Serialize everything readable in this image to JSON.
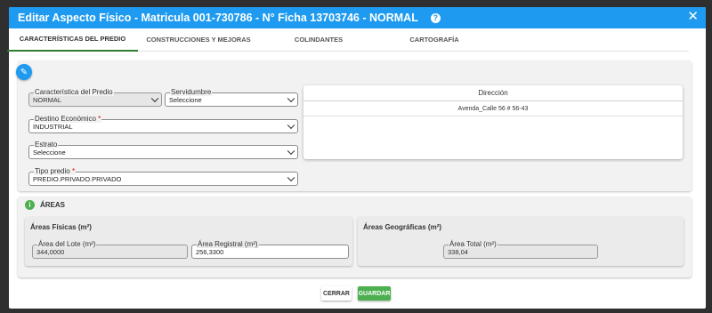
{
  "dialog": {
    "title": "Editar Aspecto Físico - Matricula 001-730786 - N° Ficha 13703746 - NORMAL",
    "help_icon": "question-circle-icon",
    "close_icon": "close-icon"
  },
  "tabs": [
    {
      "label": "CARACTERÍSTICAS DEL PREDIO",
      "active": true
    },
    {
      "label": "CONSTRUCCIONES Y MEJORAS",
      "active": false
    },
    {
      "label": "COLINDANTES",
      "active": false
    },
    {
      "label": "CARTOGRAFÍA",
      "active": false
    }
  ],
  "predio": {
    "edit_icon": "pencil-icon",
    "caracteristica": {
      "label": "Característica del Predio",
      "value": "NORMAL"
    },
    "servidumbre": {
      "label": "Servidumbre",
      "value": "Seleccione"
    },
    "destino": {
      "label": "Destino Económico",
      "required_mark": "*",
      "value": "INDUSTRIAL"
    },
    "estrato": {
      "label": "Estrato",
      "value": "Seleccione"
    },
    "tipo": {
      "label": "Tipo predio",
      "required_mark": "*",
      "value": "PREDIO.PRIVADO.PRIVADO"
    }
  },
  "direccion": {
    "header": "Dirección",
    "rows": [
      "Avenda_Calle 56 # 56-43"
    ]
  },
  "areas": {
    "title": "ÁREAS",
    "info_icon": "info-icon",
    "fisicas": {
      "title": "Áreas Físicas (m²)",
      "lote": {
        "label": "Área del Lote (m²)",
        "value": "344,0000"
      },
      "registral": {
        "label": "Área Registral (m²)",
        "value": "256,3300"
      }
    },
    "geograficas": {
      "title": "Áreas Geográficas (m²)",
      "total": {
        "label": "Área Total (m²)",
        "value": "338,04"
      }
    }
  },
  "footer": {
    "cerrar": "CERRAR",
    "guardar": "GUARDAR"
  },
  "colors": {
    "primary": "#1e9bf0",
    "success": "#4caf50",
    "required": "#dd0000"
  }
}
